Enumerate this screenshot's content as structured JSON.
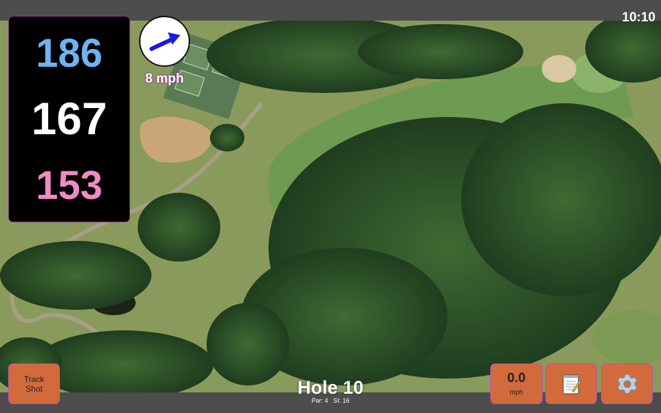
{
  "status": {
    "time": "10:10"
  },
  "distances": {
    "back": "186",
    "middle": "167",
    "front": "153"
  },
  "wind": {
    "speed_label": "8 mph",
    "arrow_icon": "wind-direction-arrow-icon",
    "arrow_color": "#1a1ae6"
  },
  "buttons": {
    "track_shot_line1": "Track",
    "track_shot_line2": "Shot",
    "speed_value": "0.0",
    "speed_unit": "mph",
    "notes_icon": "notepad-icon",
    "settings_icon": "gear-icon"
  },
  "hole": {
    "title": "Hole 10",
    "par": "Par: 4",
    "stroke_index": "SI: 16"
  },
  "colors": {
    "back": "#6eb4f2",
    "middle": "#ffffff",
    "front": "#f08ac6",
    "button": "#d36a3c",
    "accent": "#c44fb8"
  }
}
